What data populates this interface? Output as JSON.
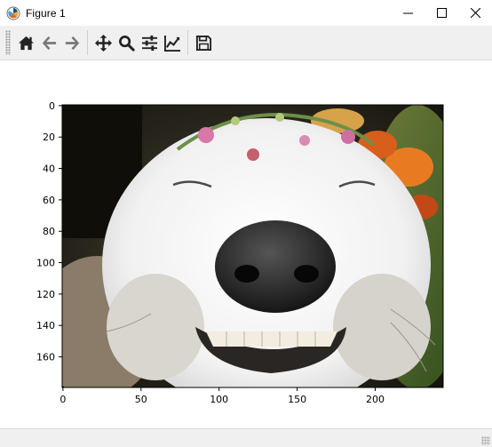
{
  "window": {
    "title": "Figure 1",
    "controls": {
      "minimize": "minimize-icon",
      "maximize": "maximize-icon",
      "close": "close-icon"
    }
  },
  "toolbar": {
    "buttons": [
      {
        "name": "home",
        "icon": "home-icon"
      },
      {
        "name": "back",
        "icon": "arrow-left-icon"
      },
      {
        "name": "forward",
        "icon": "arrow-right-icon"
      },
      {
        "name": "pan",
        "icon": "move-icon"
      },
      {
        "name": "zoom",
        "icon": "search-icon"
      },
      {
        "name": "configure-subplots",
        "icon": "sliders-icon"
      },
      {
        "name": "edit-axes",
        "icon": "line-chart-icon"
      },
      {
        "name": "save",
        "icon": "save-icon"
      }
    ]
  },
  "plot": {
    "image_subject": "smiling white dog with flower crown",
    "xaxis": {
      "ticks": [
        0,
        50,
        100,
        150,
        200
      ],
      "xlim": [
        -0.5,
        243.5
      ]
    },
    "yaxis": {
      "ticks": [
        0,
        20,
        40,
        60,
        80,
        100,
        120,
        140,
        160
      ],
      "ylim": [
        179.5,
        -0.5
      ],
      "inverted": true
    },
    "colors": {
      "frame": "#000000",
      "image_background": "#1a1a12"
    }
  }
}
